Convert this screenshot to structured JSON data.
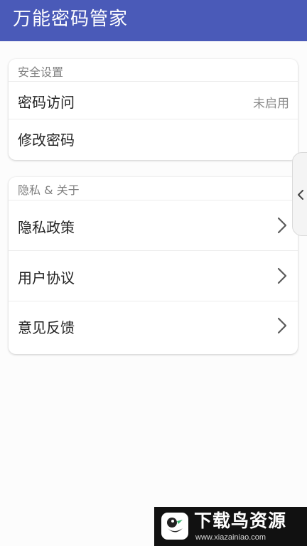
{
  "app_bar": {
    "title": "万能密码管家"
  },
  "security_section": {
    "header": "安全设置",
    "items": [
      {
        "label": "密码访问",
        "value": "未启用"
      },
      {
        "label": "修改密码"
      }
    ]
  },
  "privacy_section": {
    "header": "隐私 & 关于",
    "items": [
      {
        "label": "隐私政策",
        "icon": "chevron-right-icon"
      },
      {
        "label": "用户协议",
        "icon": "chevron-right-icon"
      },
      {
        "label": "意见反馈",
        "icon": "chevron-right-icon"
      }
    ]
  },
  "side_handle": {
    "icon": "chevron-left-icon"
  },
  "watermark": {
    "text": "下载鸟资源",
    "url": "www.xiazainiao.com"
  },
  "colors": {
    "app_bar": "#4a5ab8",
    "background": "#fcfcfc",
    "card": "#ffffff",
    "header_text": "#808080",
    "value_text": "#8a8a8a",
    "chevron": "#5a5a5a"
  }
}
